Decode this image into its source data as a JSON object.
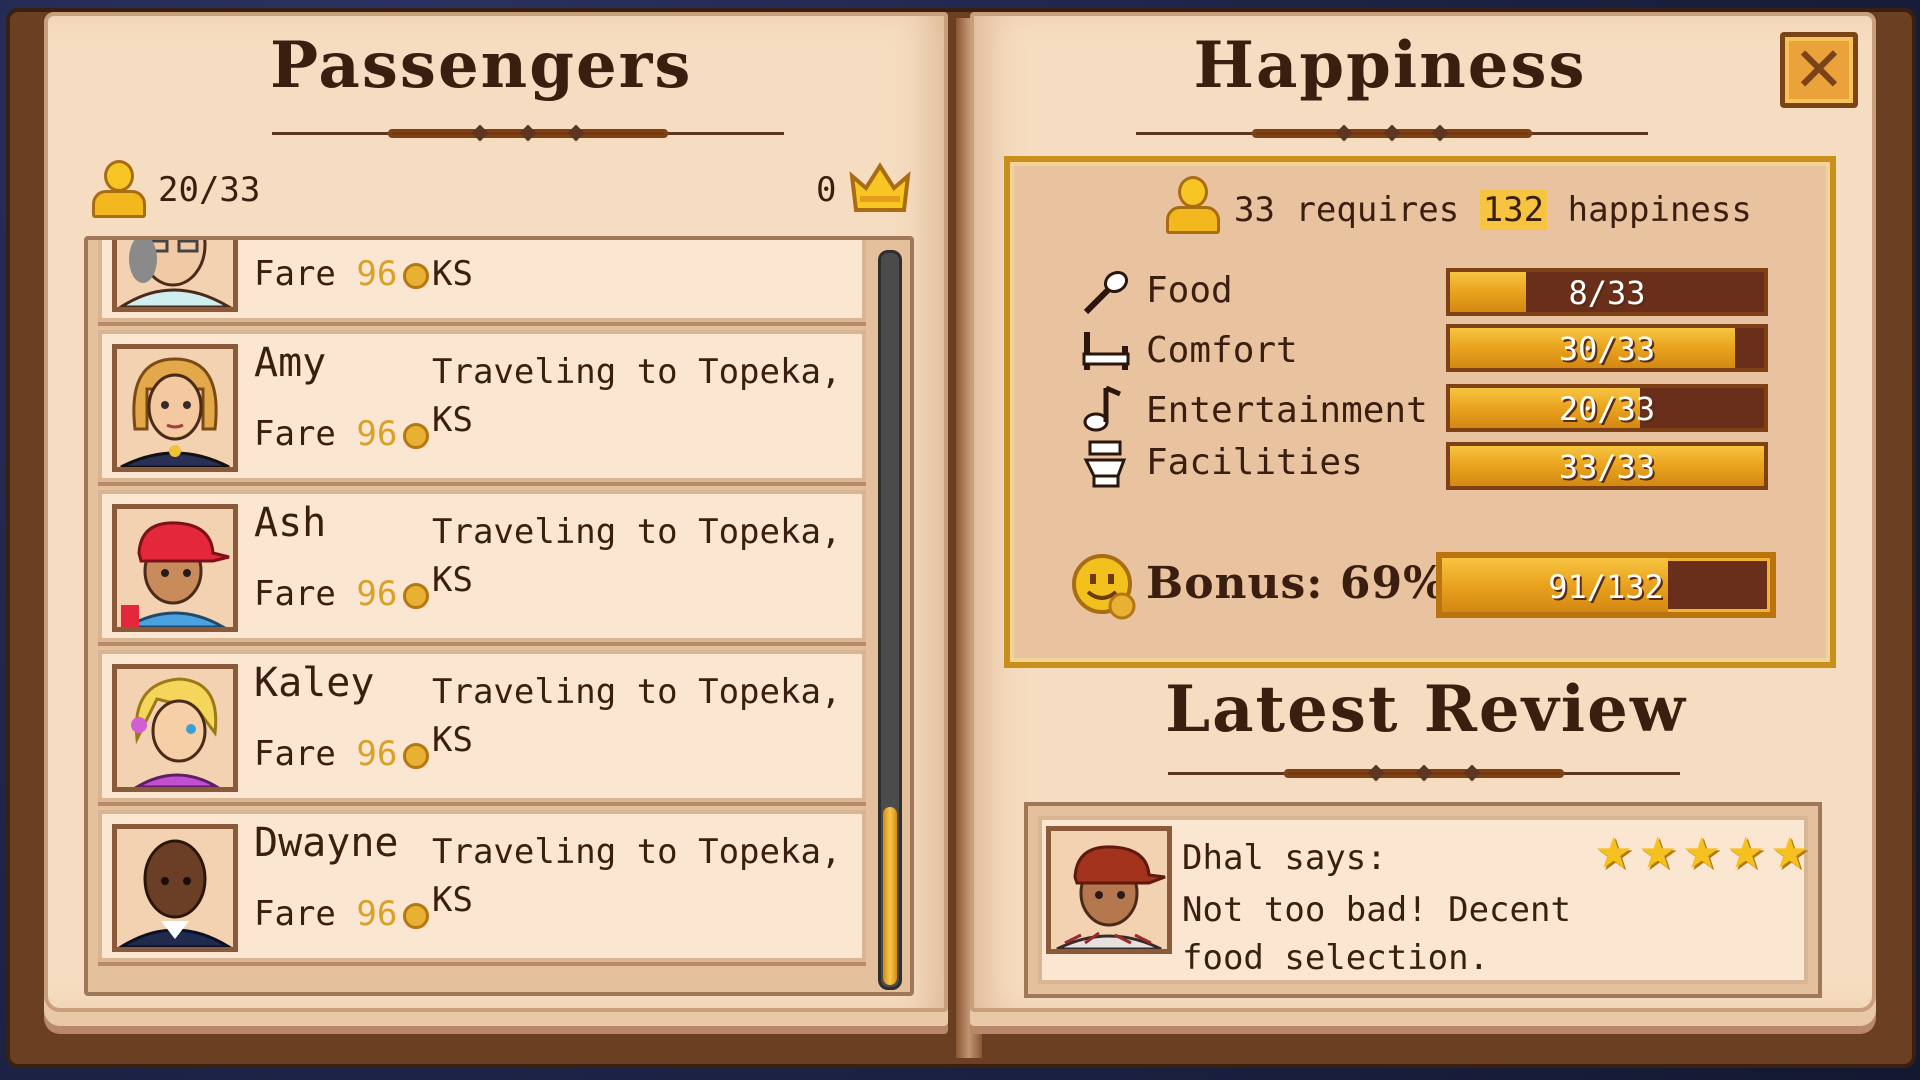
{
  "passengers": {
    "title": "Passengers",
    "count": "20/33",
    "vip_count": "0",
    "list": [
      {
        "name": "",
        "fare_label": "Fare",
        "fare_value": "96",
        "destination": "KS"
      },
      {
        "name": "Amy",
        "fare_label": "Fare",
        "fare_value": "96",
        "destination": "Traveling to Topeka, KS"
      },
      {
        "name": "Ash",
        "fare_label": "Fare",
        "fare_value": "96",
        "destination": "Traveling to Topeka, KS"
      },
      {
        "name": "Kaley",
        "fare_label": "Fare",
        "fare_value": "96",
        "destination": "Traveling to Topeka, KS"
      },
      {
        "name": "Dwayne",
        "fare_label": "Fare",
        "fare_value": "96",
        "destination": "Traveling to Topeka, KS"
      }
    ]
  },
  "happiness": {
    "title": "Happiness",
    "requirement": {
      "count": "33",
      "word1": "requires",
      "amount": "132",
      "word2": "happiness"
    },
    "stats": [
      {
        "label": "Food",
        "value": "8/33",
        "fraction": 0.2424,
        "icon": "spoon-icon"
      },
      {
        "label": "Comfort",
        "value": "30/33",
        "fraction": 0.909,
        "icon": "bed-icon"
      },
      {
        "label": "Entertainment",
        "value": "20/33",
        "fraction": 0.606,
        "icon": "music-note-icon"
      },
      {
        "label": "Facilities",
        "value": "33/33",
        "fraction": 1.0,
        "icon": "toilet-icon"
      }
    ],
    "bonus": {
      "label": "Bonus: 69%",
      "value": "91/132",
      "fraction": 0.689
    }
  },
  "review": {
    "title": "Latest Review",
    "speaker": "Dhal says:",
    "text": "Not too bad! Decent food selection.",
    "stars": 5
  },
  "colors": {
    "gold": "#f7c441",
    "bar_bg": "#6a2f1a",
    "page": "#f6dcc0",
    "ink": "#3a1e0f"
  }
}
